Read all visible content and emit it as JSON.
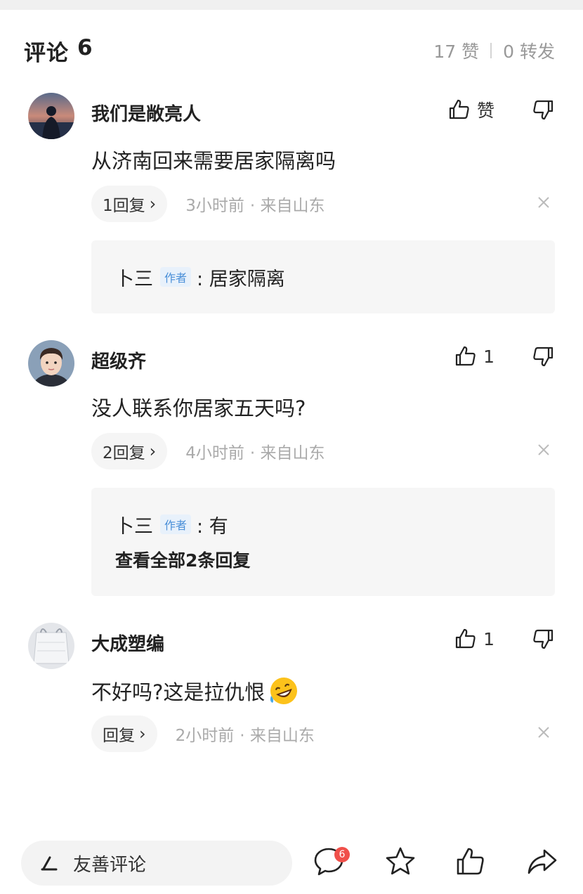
{
  "header": {
    "title": "评论",
    "count": "6",
    "likes": "17 赞",
    "shares": "0 转发"
  },
  "comments": [
    {
      "name": "我们是敞亮人",
      "text": "从济南回来需要居家隔离吗",
      "like_label": "赞",
      "reply_label": "1回复",
      "time": "3小时前",
      "location": "· 来自山东",
      "replies": [
        {
          "author": "卜三",
          "tag": "作者",
          "text": ": 居家隔离"
        }
      ]
    },
    {
      "name": "超级齐",
      "text": "没人联系你居家五天吗?",
      "like_label": "1",
      "reply_label": "2回复",
      "time": "4小时前",
      "location": "· 来自山东",
      "replies": [
        {
          "author": "卜三",
          "tag": "作者",
          "text": ": 有"
        }
      ],
      "see_all": "查看全部2条回复"
    },
    {
      "name": "大成塑编",
      "text": "不好吗?这是拉仇恨",
      "like_label": "1",
      "reply_label": "回复",
      "time": "2小时前",
      "location": "· 来自山东"
    }
  ],
  "bottom_bar": {
    "input_placeholder": "友善评论",
    "comment_badge": "6",
    "icons": [
      "comment-icon",
      "star-icon",
      "thumbs-up-icon",
      "share-icon"
    ]
  },
  "colors": {
    "badge": "#f0504a",
    "author_tag": "#4a8fd8",
    "muted": "#999999"
  }
}
